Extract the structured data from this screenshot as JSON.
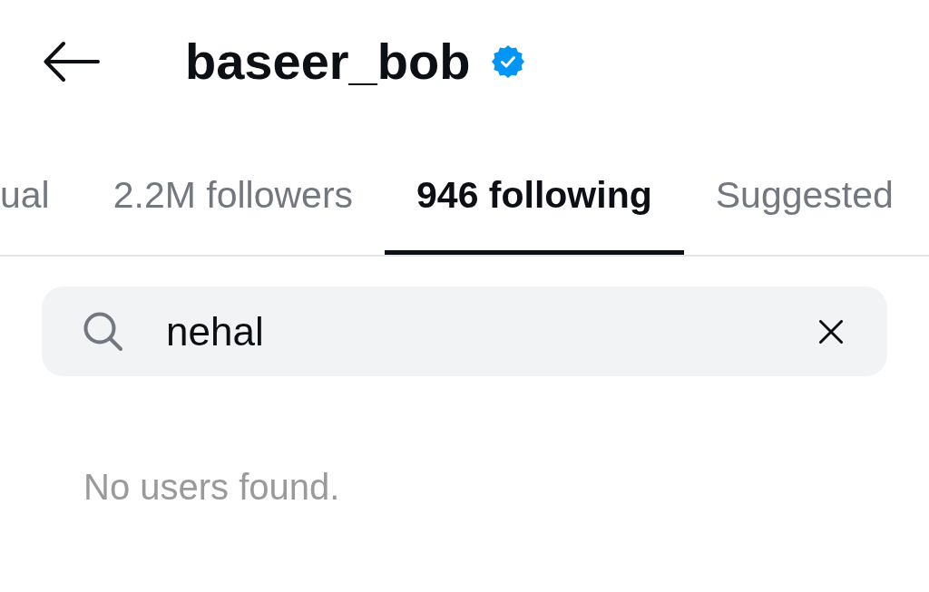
{
  "header": {
    "title": "baseer_bob",
    "verified": true
  },
  "tabs": [
    {
      "label": "ual",
      "selected": false
    },
    {
      "label": "2.2M followers",
      "selected": false
    },
    {
      "label": "946 following",
      "selected": true
    },
    {
      "label": "Suggested",
      "selected": false
    }
  ],
  "search": {
    "value": "nehal"
  },
  "empty_message": "No users found."
}
